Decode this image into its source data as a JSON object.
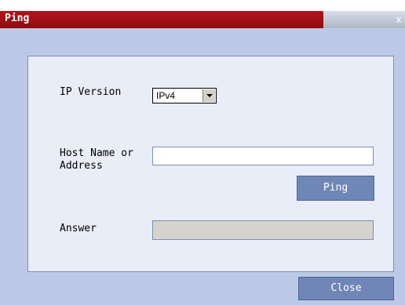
{
  "window": {
    "title": "Ping",
    "close_glyph": "x"
  },
  "form": {
    "ip_version_label": "IP Version",
    "ip_version_value": "IPv4",
    "host_label": "Host Name or Address",
    "host_value": "",
    "ping_label": "Ping",
    "answer_label": "Answer",
    "answer_value": ""
  },
  "footer": {
    "close_label": "Close"
  },
  "colors": {
    "title_bar": "#b3141a",
    "background": "#bcc9e6",
    "panel": "#e9edf8",
    "button": "#6f86b6"
  },
  "icons": {
    "close": "close-icon",
    "dropdown": "chevron-down-icon"
  }
}
